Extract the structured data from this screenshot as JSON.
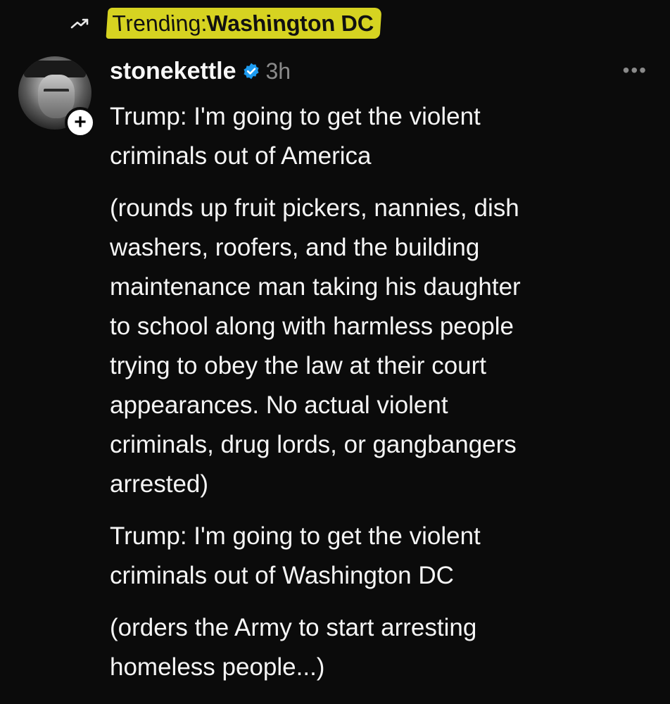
{
  "trending": {
    "icon": "trending-arrow-icon",
    "prefix": "Trending",
    "colon": ": ",
    "topic": "Washington DC",
    "highlight_color": "#d6d321"
  },
  "post": {
    "username": "stonekettle",
    "verified": true,
    "verified_color": "#1d9bf0",
    "time": "3h",
    "more_label": "•••",
    "follow_symbol": "+",
    "paragraphs": [
      [
        "Trump: I'm going to get the violent",
        "criminals out of America"
      ],
      [
        "(rounds up fruit pickers, nannies, dish",
        "washers, roofers, and the building",
        "maintenance man taking his daughter",
        "to school along with harmless people",
        "trying to obey the law at their court",
        "appearances. No actual violent",
        "criminals, drug lords, or gangbangers",
        "arrested)"
      ],
      [
        "Trump: I'm going to get the violent",
        "criminals out of Washington DC"
      ],
      [
        "(orders the Army to start arresting",
        "homeless people...)"
      ]
    ]
  }
}
